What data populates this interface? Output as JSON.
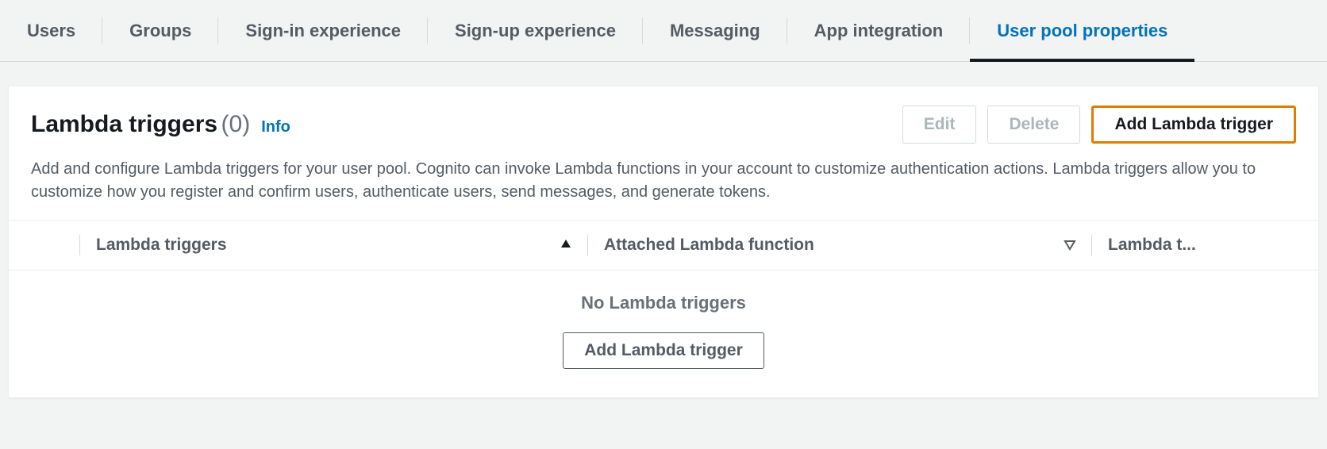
{
  "tabs": [
    {
      "label": "Users"
    },
    {
      "label": "Groups"
    },
    {
      "label": "Sign-in experience"
    },
    {
      "label": "Sign-up experience"
    },
    {
      "label": "Messaging"
    },
    {
      "label": "App integration"
    },
    {
      "label": "User pool properties"
    }
  ],
  "panel": {
    "title": "Lambda triggers",
    "count": "(0)",
    "info": "Info",
    "description": "Add and configure Lambda triggers for your user pool. Cognito can invoke Lambda functions in your account to customize authentication actions. Lambda triggers allow you to customize how you register and confirm users, authenticate users, send messages, and generate tokens.",
    "actions": {
      "edit": "Edit",
      "delete": "Delete",
      "add": "Add Lambda trigger"
    }
  },
  "table": {
    "columns": [
      "Lambda triggers",
      "Attached Lambda function",
      "Lambda t..."
    ],
    "empty_message": "No Lambda triggers",
    "empty_action": "Add Lambda trigger"
  }
}
